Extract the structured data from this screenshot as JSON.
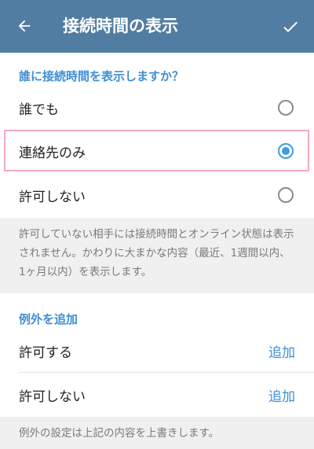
{
  "appbar": {
    "title": "接続時間の表示",
    "back_icon": "arrow-left-icon",
    "confirm_icon": "checkmark-icon",
    "color": "#517da2"
  },
  "who_can_see": {
    "header": "誰に接続時間を表示しますか？",
    "options": [
      {
        "label": "誰でも",
        "selected": false
      },
      {
        "label": "連絡先のみ",
        "selected": true
      },
      {
        "label": "許可しない",
        "selected": false
      }
    ],
    "info": "許可していない相手には接続時間とオンライン状態は表示されません。かわりに大まかな内容（最近、1週間以内、1ヶ月以内）を表示します。"
  },
  "exceptions": {
    "header": "例外を追加",
    "items": [
      {
        "label": "許可する",
        "action": "追加"
      },
      {
        "label": "許可しない",
        "action": "追加"
      }
    ],
    "info": "例外の設定は上記の内容を上書きします。"
  },
  "colors": {
    "accent": "#3e8ed3",
    "radio_on": "#3d9de0",
    "highlight": "#f3a9c9"
  }
}
